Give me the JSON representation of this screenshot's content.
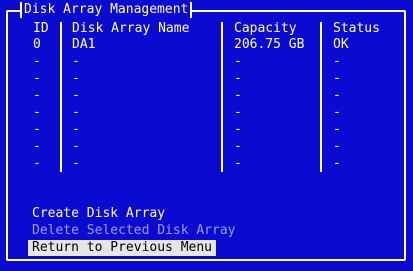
{
  "window": {
    "title": "Disk Array Management"
  },
  "table": {
    "headers": [
      "ID",
      "Disk Array Name",
      "Capacity",
      "Status"
    ],
    "rows": [
      [
        "0",
        "DA1",
        "206.75 GB",
        "OK"
      ],
      [
        "-",
        "-",
        "-",
        "-"
      ],
      [
        "-",
        "-",
        "-",
        "-"
      ],
      [
        "-",
        "-",
        "-",
        "-"
      ],
      [
        "-",
        "-",
        "-",
        "-"
      ],
      [
        "-",
        "-",
        "-",
        "-"
      ],
      [
        "-",
        "-",
        "-",
        "-"
      ],
      [
        "-",
        "-",
        "-",
        "-"
      ]
    ]
  },
  "menu": [
    {
      "label": "Create Disk Array",
      "state": "enabled"
    },
    {
      "label": "Delete Selected Disk Array",
      "state": "disabled"
    },
    {
      "label": "Return to Previous Menu",
      "state": "selected"
    }
  ],
  "colors": {
    "background": "#0a0ad0",
    "text": "#ffffff",
    "disabled": "#9aa0ff",
    "highlight": "#e6e6e6"
  }
}
